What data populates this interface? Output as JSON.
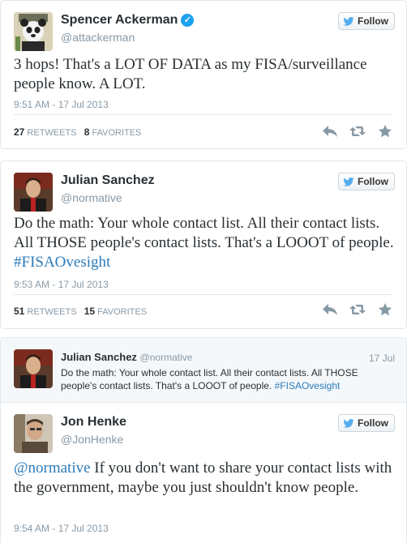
{
  "tweets": [
    {
      "name": "Spencer Ackerman",
      "handle": "@attackerman",
      "verified": true,
      "follow_label": "Follow",
      "text": "3 hops! That's a LOT OF DATA as my FISA/surveillance people know. A LOT.",
      "timestamp": "9:51 AM - 17 Jul 2013",
      "retweets": "27",
      "retweets_label": "RETWEETS",
      "favorites": "8",
      "favorites_label": "FAVORITES"
    },
    {
      "name": "Julian Sanchez",
      "handle": "@normative",
      "follow_label": "Follow",
      "text_main": "Do the math: Your whole contact list. All their contact lists. All THOSE people's contact lists. That's a LOOOT of people. ",
      "hashtag": "#FISAOvesight",
      "timestamp": "9:53 AM - 17 Jul 2013",
      "retweets": "51",
      "retweets_label": "RETWEETS",
      "favorites": "15",
      "favorites_label": "FAVORITES"
    },
    {
      "quoted": {
        "name": "Julian Sanchez",
        "handle": "@normative",
        "date": "17 Jul",
        "text_main": "Do the math: Your whole contact list. All their contact lists. All THOSE people's contact lists. That's a LOOOT of people. ",
        "hashtag": "#FISAOvesight"
      },
      "name": "Jon Henke",
      "handle": "@JonHenke",
      "follow_label": "Follow",
      "mention": "@normative",
      "text_main": " If you don't want to share your contact lists with the government, maybe you just shouldn't know people.",
      "timestamp": "9:54 AM - 17 Jul 2013"
    }
  ],
  "icons": {
    "reply": "reply-icon",
    "retweet": "retweet-icon",
    "favorite": "star-icon",
    "bird": "twitter-bird-icon",
    "verified": "verified-badge-icon"
  },
  "colors": {
    "link": "#2b7bb9",
    "verified": "#1da1f2",
    "bird": "#55acee"
  }
}
